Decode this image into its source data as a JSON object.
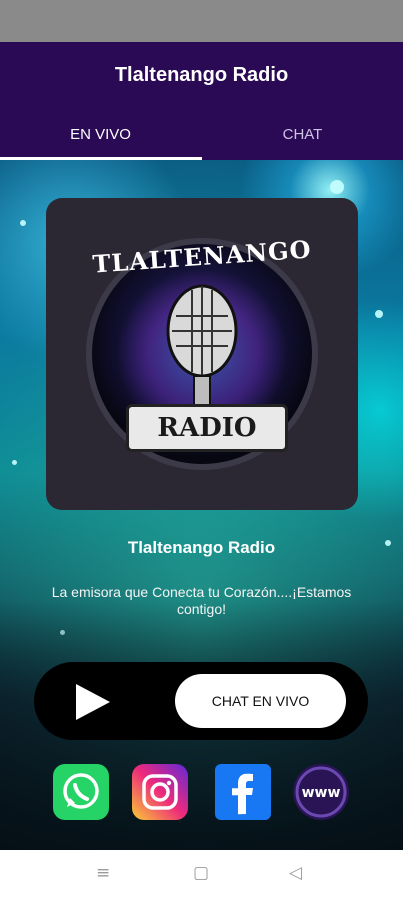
{
  "app": {
    "title": "Tlaltenango Radio"
  },
  "tabs": [
    {
      "label": "EN VIVO",
      "selected": true
    },
    {
      "label": "CHAT",
      "selected": false
    }
  ],
  "cover": {
    "top_text": "TLALTENANGO",
    "banner_text": "RADIO"
  },
  "station": {
    "name": "Tlaltenango Radio",
    "description": "La emisora que Conecta tu Corazón....¡Estamos contigo!"
  },
  "player": {
    "play_icon": "play-icon",
    "chat_button_label": "CHAT EN VIVO"
  },
  "social": [
    {
      "name": "whatsapp-icon",
      "color": "#25d366"
    },
    {
      "name": "instagram-icon",
      "color": "#ee2a7b"
    },
    {
      "name": "facebook-icon",
      "color": "#1877f2"
    },
    {
      "name": "www-icon",
      "color": "#2a1456",
      "text": "www"
    }
  ],
  "nav": {
    "menu_icon": "≡",
    "home_icon": "▢",
    "back_icon": "◁"
  },
  "colors": {
    "appbar": "#2a0a54",
    "statusbar": "#8a8a8a",
    "accent_white": "#ffffff"
  }
}
